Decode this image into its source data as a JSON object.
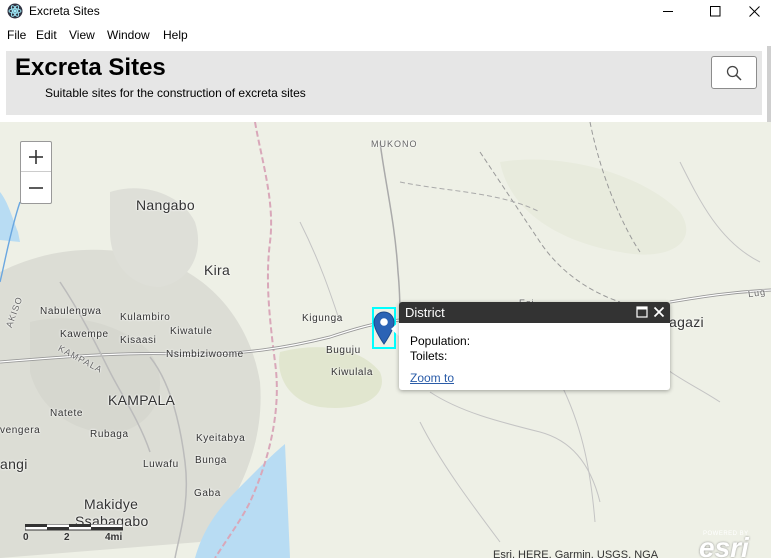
{
  "window": {
    "title": "Excreta Sites",
    "controls": {
      "minimize_icon": "minimize-icon",
      "maximize_icon": "maximize-icon",
      "close_icon": "close-icon"
    }
  },
  "menu": [
    "File",
    "Edit",
    "View",
    "Window",
    "Help"
  ],
  "header": {
    "title": "Excreta Sites",
    "subtitle": "Suitable sites for the construction of excreta sites",
    "search_icon": "search-icon"
  },
  "map": {
    "zoom_in_label": "+",
    "zoom_out_label": "−",
    "places": {
      "mukono": "MUKONO",
      "nangabo": "Nangabo",
      "kira": "Kira",
      "nabulengwa": "Nabulengwa",
      "kulambiro": "Kulambiro",
      "kawempe": "Kawempe",
      "kiwatule": "Kiwatule",
      "kisaasi": "Kisaasi",
      "nsimbiziwoome": "Nsimbiziwoome",
      "kigunga": "Kigunga",
      "buguju": "Buguju",
      "kiwulala": "Kiwulala",
      "kampala_upper": "KAMPALA",
      "kampala": "KAMPALA",
      "natete": "Natete",
      "rubaga": "Rubaga",
      "kyeitabya": "Kyeitabya",
      "mengera": "vengera",
      "bunga": "Bunga",
      "luwafu": "Luwafu",
      "angi": "angi",
      "gaba": "Gaba",
      "makidye": "Makidye",
      "ssabagabo": "Ssabagabo",
      "akiso": "AKISO",
      "agazi": "agazi",
      "lug": "Lug",
      "esi": "Esi"
    },
    "popup": {
      "title": "District",
      "population_label": "Population:",
      "toilets_label": "Toilets:",
      "zoom_link": "Zoom to"
    },
    "scale": {
      "labels": [
        "0",
        "2",
        "4mi"
      ]
    },
    "attribution": "Esri, HERE, Garmin, USGS, NGA",
    "esri_logo": {
      "powered_by": "POWERED BY",
      "brand": "esri"
    }
  }
}
